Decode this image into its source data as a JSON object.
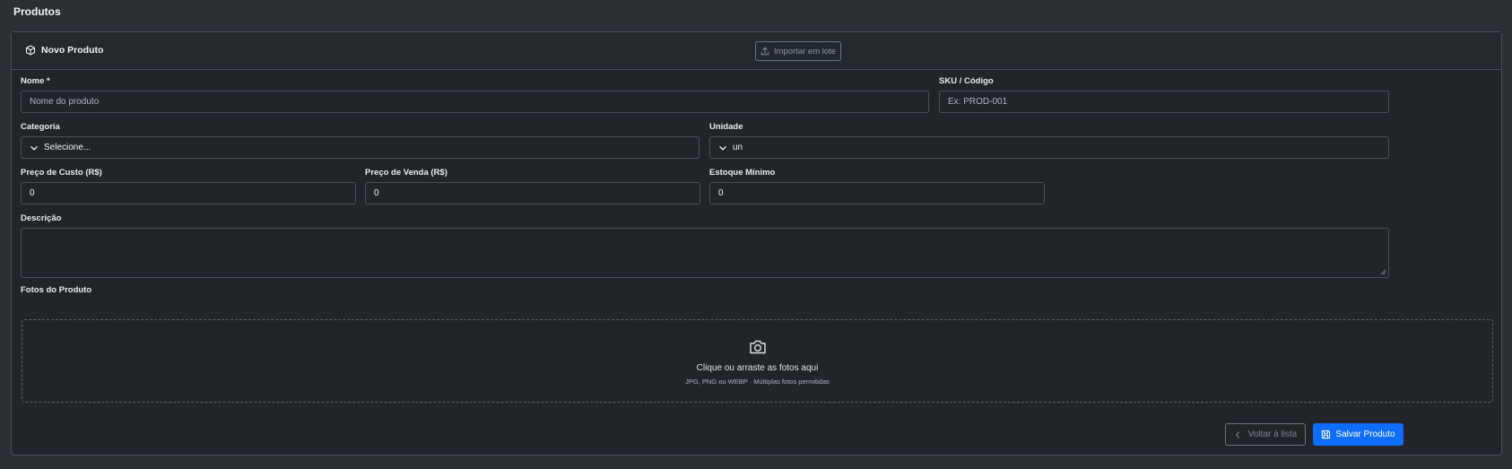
{
  "page": {
    "title": "Produtos"
  },
  "card": {
    "title": "Novo Produto",
    "title_icon": "box-icon",
    "import_label": "Importar em lote",
    "import_icon": "upload-icon"
  },
  "form": {
    "nome": {
      "label": "Nome *",
      "placeholder": "Nome do produto",
      "value": ""
    },
    "sku": {
      "label": "SKU / Código",
      "placeholder": "Ex: PROD-001",
      "value": ""
    },
    "categoria": {
      "label": "Categoria",
      "selected": "Selecione..."
    },
    "unidade": {
      "label": "Unidade",
      "selected": "un"
    },
    "preco_custo": {
      "label": "Preço de Custo (R$)",
      "value": "0"
    },
    "preco_venda": {
      "label": "Preço de Venda (R$)",
      "value": "0"
    },
    "estoque_minimo": {
      "label": "Estoque Mínimo",
      "value": "0"
    },
    "descricao": {
      "label": "Descrição",
      "value": ""
    },
    "fotos": {
      "label": "Fotos do Produto",
      "dropzone_text": "Clique ou arraste as fotos aqui",
      "dropzone_hint": "JPG, PNG ou WEBP · Múltiplas fotos permitidas",
      "icon": "camera-icon"
    }
  },
  "actions": {
    "back_label": "Voltar à lista",
    "back_icon": "chevron-left-icon",
    "save_label": "Salvar Produto",
    "save_icon": "save-icon"
  },
  "colors": {
    "background": "#2b3035",
    "card": "#212529",
    "border": "#495057",
    "primary": "#0d6efd"
  }
}
